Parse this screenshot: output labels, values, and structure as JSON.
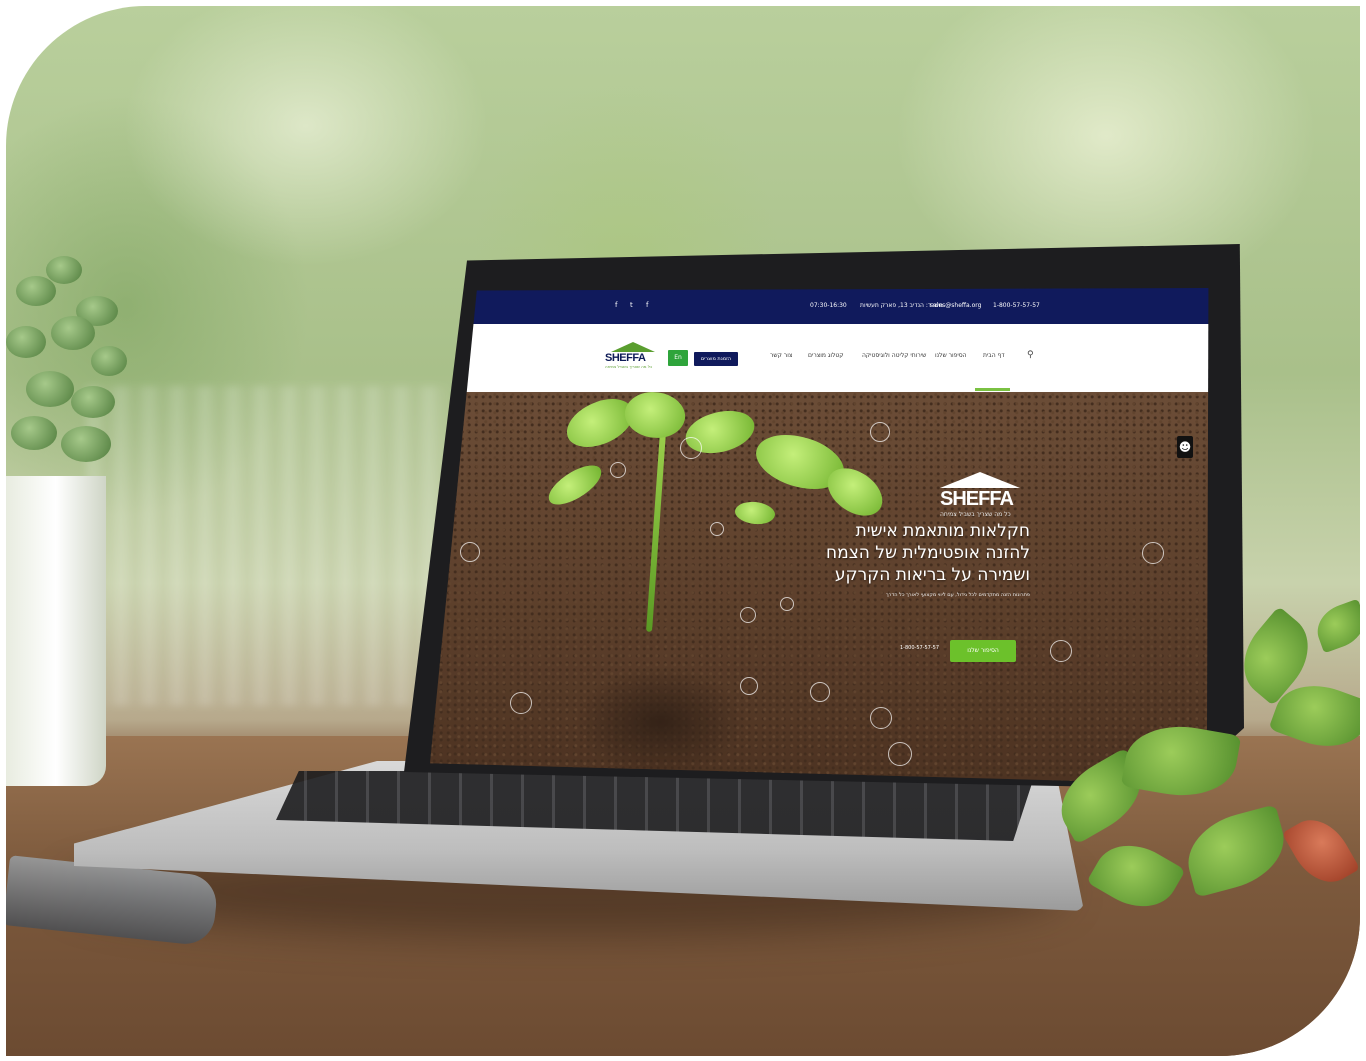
{
  "topbar": {
    "contact": [
      {
        "icon": "phone-icon",
        "text": "1-800-57-57-57"
      },
      {
        "icon": "mail-icon",
        "text": "sales@sheffa.org"
      },
      {
        "icon": "location-icon",
        "text": "משרד: הנדיב 13, פארק תעשיות"
      },
      {
        "icon": "clock-icon",
        "text": "07:30-16:30"
      }
    ],
    "social": [
      "f",
      "t",
      "f"
    ]
  },
  "nav": {
    "items": [
      "דף הבית",
      "הסיפור שלנו",
      "שירותי קליטה ולוגיסטיקה",
      "קטלוג מוצרים",
      "צור קשר"
    ],
    "cta_green": "En",
    "cta_navy": "הזמנת מוצרים",
    "logo_text": "SHEFFA",
    "logo_sub": "כל מה שצריך בשביל צמיחה"
  },
  "hero": {
    "logo_text": "SHEFFA",
    "logo_sub": "כל מה שצריך בשביל צמיחה",
    "headline_1": "חקלאות מותאמת אישית",
    "headline_2": "להזנה אופטימלית של הצמח",
    "headline_3": "ושמירה על בריאות הקרקע",
    "subline": "פתרונות הזנה מתקדמים לכל גידול, עם ליווי מקצועי לאורך כל הדרך",
    "cta": "הסיפור שלנו",
    "phone": "1-800-57-57-57"
  },
  "accessibility": {
    "icon": "accessibility-icon"
  },
  "colors": {
    "navy": "#101a5c",
    "green": "#6cc12b",
    "soil": "#6b4b33"
  }
}
